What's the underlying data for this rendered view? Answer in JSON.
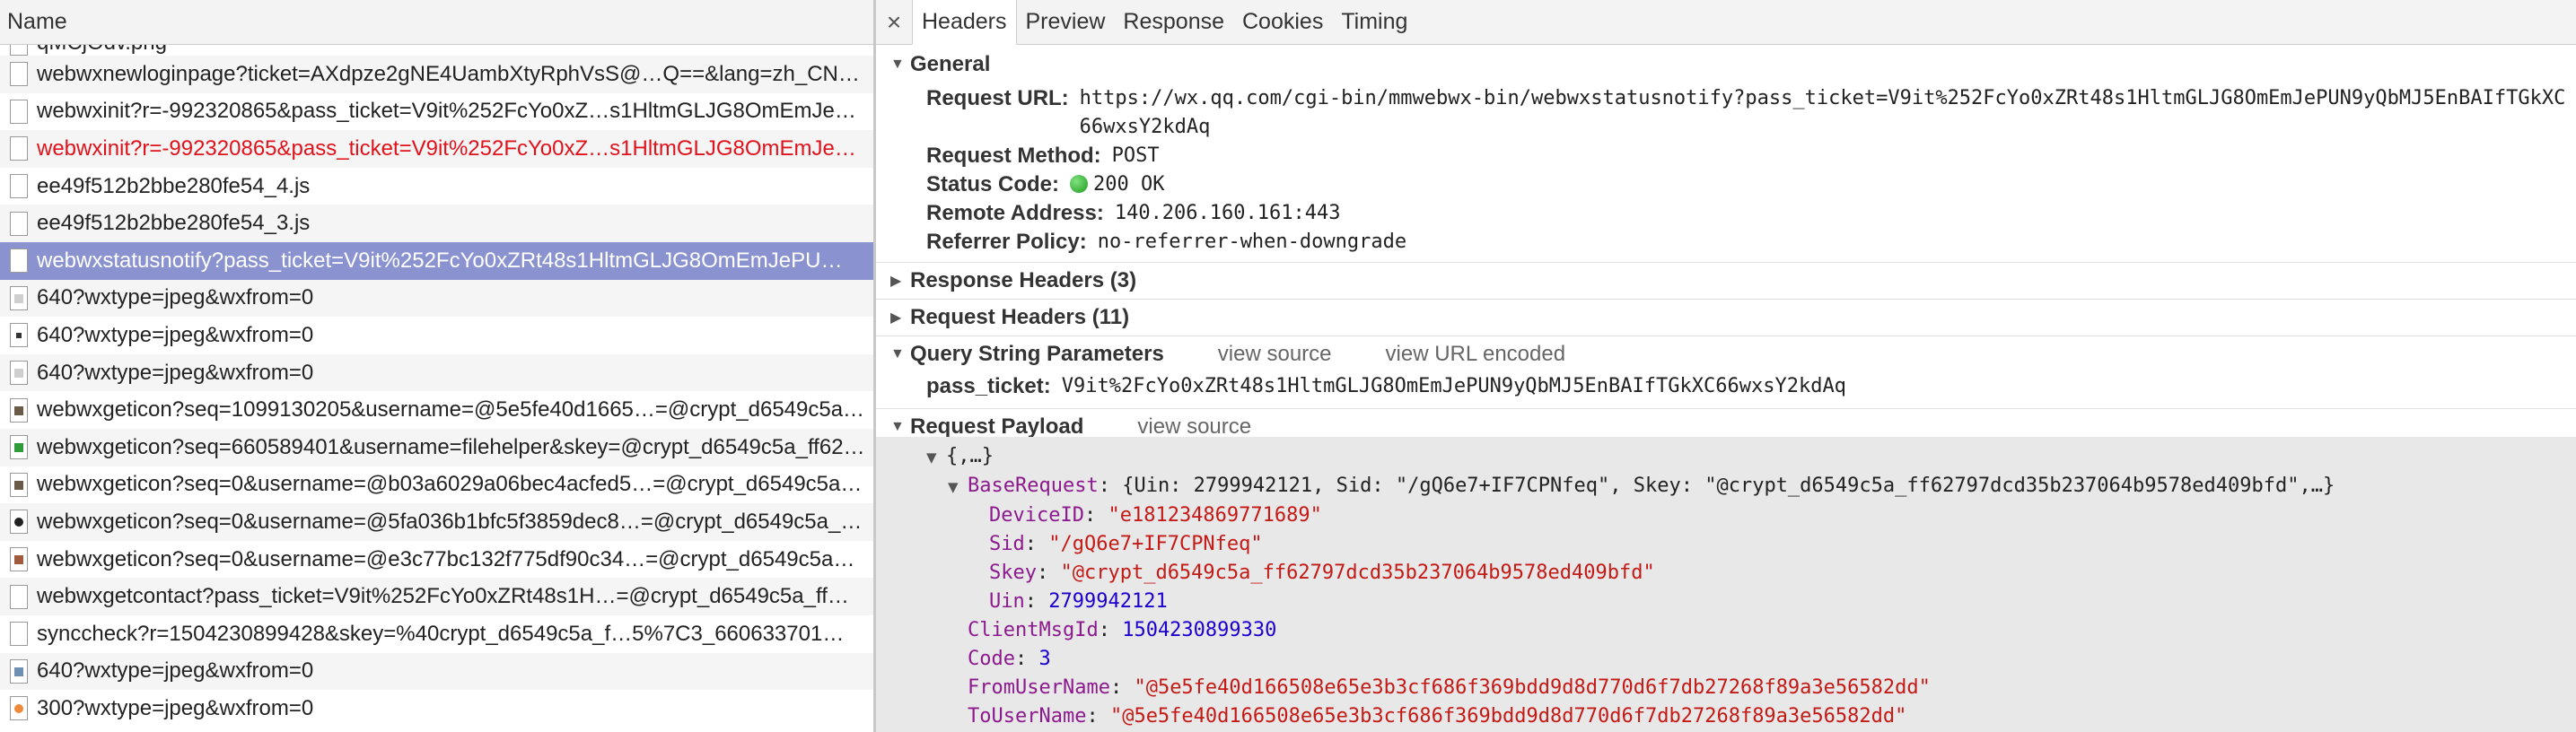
{
  "left_header": {
    "title": "Name"
  },
  "requests": [
    {
      "name": "qMCjOdv.png",
      "icon": "file-icon",
      "partial": true
    },
    {
      "name": "webwxnewloginpage?ticket=AXdpze2gNE4UambXtyRphVsS@…Q==&lang=zh_CN…",
      "icon": "file-icon"
    },
    {
      "name": "webwxinit?r=-992320865&pass_ticket=V9it%252FcYo0xZ…s1HltmGLJG8OmEmJe…",
      "icon": "file-icon"
    },
    {
      "name": "webwxinit?r=-992320865&pass_ticket=V9it%252FcYo0xZ…s1HltmGLJG8OmEmJe…",
      "icon": "file-icon",
      "error": true
    },
    {
      "name": "ee49f512b2bbe280fe54_4.js",
      "icon": "file-icon"
    },
    {
      "name": "ee49f512b2bbe280fe54_3.js",
      "icon": "file-icon"
    },
    {
      "name": "webwxstatusnotify?pass_ticket=V9it%252FcYo0xZRt48s1HltmGLJG8OmEmJePU…",
      "icon": "file-icon",
      "selected": true
    },
    {
      "name": "640?wxtype=jpeg&wxfrom=0",
      "icon": "image-icon",
      "variant": "img-gray"
    },
    {
      "name": "640?wxtype=jpeg&wxfrom=0",
      "icon": "image-icon",
      "variant": "img-dark"
    },
    {
      "name": "640?wxtype=jpeg&wxfrom=0",
      "icon": "image-icon",
      "variant": "img-gray"
    },
    {
      "name": "webwxgeticon?seq=1099130205&username=@5e5fe40d1665…=@crypt_d6549c5a…",
      "icon": "image-icon",
      "variant": "img-pic"
    },
    {
      "name": "webwxgeticon?seq=660589401&username=filehelper&skey=@crypt_d6549c5a_ff62…",
      "icon": "image-icon",
      "variant": "img-green"
    },
    {
      "name": "webwxgeticon?seq=0&username=@b03a6029a06bec4acfed5…=@crypt_d6549c5a…",
      "icon": "image-icon",
      "variant": "img-pic"
    },
    {
      "name": "webwxgeticon?seq=0&username=@5fa036b1bfc5f3859dec8…=@crypt_d6549c5a_…",
      "icon": "image-icon",
      "variant": "img-ring"
    },
    {
      "name": "webwxgeticon?seq=0&username=@e3c77bc132f775df90c34…=@crypt_d6549c5a…",
      "icon": "image-icon",
      "variant": "img-brown"
    },
    {
      "name": "webwxgetcontact?pass_ticket=V9it%252FcYo0xZRt48s1H…=@crypt_d6549c5a_ff…",
      "icon": "file-icon"
    },
    {
      "name": "synccheck?r=1504230899428&skey=%40crypt_d6549c5a_f…5%7C3_660633701…",
      "icon": "file-icon"
    },
    {
      "name": "640?wxtype=jpeg&wxfrom=0",
      "icon": "image-icon",
      "variant": "img-blue"
    },
    {
      "name": "300?wxtype=jpeg&wxfrom=0",
      "icon": "image-icon",
      "variant": "img-orange"
    }
  ],
  "tabs": {
    "close": "×",
    "headers": "Headers",
    "preview": "Preview",
    "response": "Response",
    "cookies": "Cookies",
    "timing": "Timing"
  },
  "general": {
    "title": "General",
    "request_url_label": "Request URL:",
    "request_url": "https://wx.qq.com/cgi-bin/mmwebwx-bin/webwxstatusnotify?pass_ticket=V9it%252FcYo0xZRt48s1HltmGLJG8OmEmJePUN9yQbMJ5EnBAIfTGkXC66wxsY2kdAq",
    "request_method_label": "Request Method:",
    "request_method": "POST",
    "status_code_label": "Status Code:",
    "status_code": "200 OK",
    "status_color": "#2aa52a",
    "remote_address_label": "Remote Address:",
    "remote_address": "140.206.160.161:443",
    "referrer_policy_label": "Referrer Policy:",
    "referrer_policy": "no-referrer-when-downgrade"
  },
  "response_headers": {
    "title": "Response Headers (3)"
  },
  "request_headers": {
    "title": "Request Headers (11)"
  },
  "query_string": {
    "title": "Query String Parameters",
    "view_source": "view source",
    "view_url_encoded": "view URL encoded",
    "param_key": "pass_ticket:",
    "param_value": "V9it%2FcYo0xZRt48s1HltmGLJG8OmEmJePUN9yQbMJ5EnBAIfTGkXC66wxsY2kdAq"
  },
  "payload": {
    "title": "Request Payload",
    "view_source": "view source",
    "root_summary": "{,…}",
    "base_request_key": "BaseRequest",
    "base_request_summary": "{Uin: 2799942121, Sid: \"/gQ6e7+IF7CPNfeq\", Skey: \"@crypt_d6549c5a_ff62797dcd35b237064b9578ed409bfd\",…}",
    "device_id_key": "DeviceID",
    "device_id": "\"e181234869771689\"",
    "sid_key": "Sid",
    "sid": "\"/gQ6e7+IF7CPNfeq\"",
    "skey_key": "Skey",
    "skey": "\"@crypt_d6549c5a_ff62797dcd35b237064b9578ed409bfd\"",
    "uin_key": "Uin",
    "uin": "2799942121",
    "client_msg_id_key": "ClientMsgId",
    "client_msg_id": "1504230899330",
    "code_key": "Code",
    "code": "3",
    "from_user_key": "FromUserName",
    "from_user": "\"@5e5fe40d166508e65e3b3cf686f369bdd9d8d770d6f7db27268f89a3e56582dd\"",
    "to_user_key": "ToUserName",
    "to_user": "\"@5e5fe40d166508e65e3b3cf686f369bdd9d8d770d6f7db27268f89a3e56582dd\""
  }
}
